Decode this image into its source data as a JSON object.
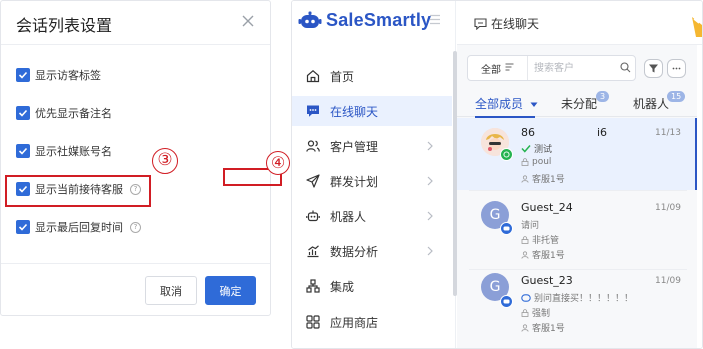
{
  "dialog": {
    "title": "会话列表设置",
    "options": [
      {
        "label": "显示访客标签",
        "checked": true
      },
      {
        "label": "优先显示备注名",
        "checked": true
      },
      {
        "label": "显示社媒账号名",
        "checked": true
      },
      {
        "label": "显示当前接待客服",
        "checked": true,
        "help": "?"
      },
      {
        "label": "显示最后回复时间",
        "checked": true,
        "help": "?"
      }
    ],
    "cancel_label": "取消",
    "confirm_label": "确定",
    "step_marker": "③"
  },
  "app": {
    "logo_text": "SaleSmartly",
    "nav": [
      {
        "label": "首页",
        "icon": "home-icon"
      },
      {
        "label": "在线聊天",
        "icon": "chat-icon",
        "active": true
      },
      {
        "label": "客户管理",
        "icon": "users-icon",
        "has_children": true
      },
      {
        "label": "群发计划",
        "icon": "send-icon",
        "has_children": true
      },
      {
        "label": "机器人",
        "icon": "robot-icon",
        "has_children": true
      },
      {
        "label": "数据分析",
        "icon": "chart-icon",
        "has_children": true
      },
      {
        "label": "集成",
        "icon": "integration-icon"
      },
      {
        "label": "应用商店",
        "icon": "apps-icon"
      }
    ],
    "main_title": "在线聊天",
    "filter": {
      "label": "全部",
      "search_placeholder": "搜索客户"
    },
    "tabs": [
      {
        "label": "全部成员",
        "active": true
      },
      {
        "label": "未分配",
        "count": "3"
      },
      {
        "label": "机器人",
        "count": "15"
      }
    ],
    "conversations": [
      {
        "name": "86",
        "name_suffix": "i6",
        "time": "11/13",
        "message": "测试",
        "account": "poul",
        "agent": "客服1号",
        "channel": "whatsapp",
        "avatar": ""
      },
      {
        "name": "Guest_24",
        "time": "11/09",
        "message": "请问",
        "account": "非托管",
        "agent": "客服1号",
        "channel": "chat",
        "avatar": "G"
      },
      {
        "name": "Guest_23",
        "time": "11/09",
        "message": "别问直接买！！！！！！",
        "account": "强制",
        "agent": "客服1号",
        "channel": "chat",
        "avatar": "G"
      }
    ],
    "step_marker": "④"
  },
  "colors": {
    "accent": "#2b56c5",
    "checkbox": "#2f6bd8",
    "highlight": "#d11d24",
    "selected_bg": "#eaf1fe",
    "whatsapp": "#25b350"
  }
}
